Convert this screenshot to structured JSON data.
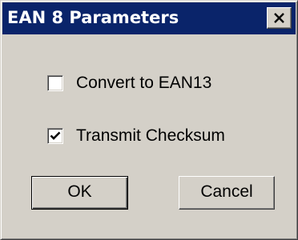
{
  "window": {
    "title": "EAN 8 Parameters",
    "titlebar_color": "#0a246a",
    "close_icon": "close-icon"
  },
  "options": [
    {
      "label": "Convert to EAN13",
      "checked": false
    },
    {
      "label": "Transmit Checksum",
      "checked": true
    }
  ],
  "buttons": {
    "ok_label": "OK",
    "cancel_label": "Cancel"
  }
}
